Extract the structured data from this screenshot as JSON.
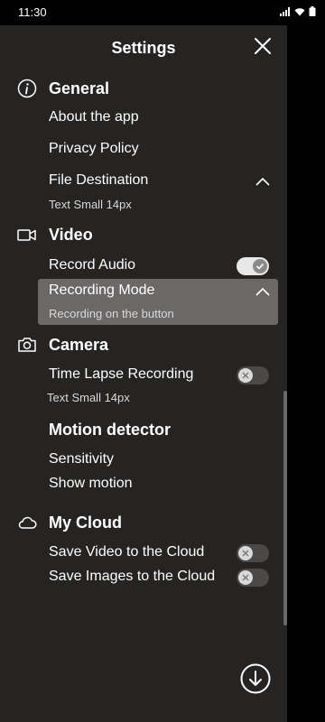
{
  "status": {
    "time": "11:30"
  },
  "header": {
    "title": "Settings"
  },
  "general": {
    "title": "General",
    "about": "About the app",
    "privacy": "Privacy Policy",
    "file_destination": "File Destination",
    "file_destination_sub": "Text Small 14px"
  },
  "video": {
    "title": "Video",
    "record_audio": "Record Audio",
    "record_audio_on": true,
    "recording_mode": "Recording Mode",
    "recording_mode_sub": "Recording on the button"
  },
  "camera": {
    "title": "Camera",
    "time_lapse": "Time Lapse Recording",
    "time_lapse_on": false,
    "time_lapse_sub": "Text Small 14px"
  },
  "motion": {
    "title": "Motion detector",
    "sensitivity": "Sensitivity",
    "show_motion": "Show motion"
  },
  "cloud": {
    "title": "My Cloud",
    "save_video": "Save Video to the Cloud",
    "save_video_on": false,
    "save_images": "Save Images to the Cloud",
    "save_images_on": false
  }
}
